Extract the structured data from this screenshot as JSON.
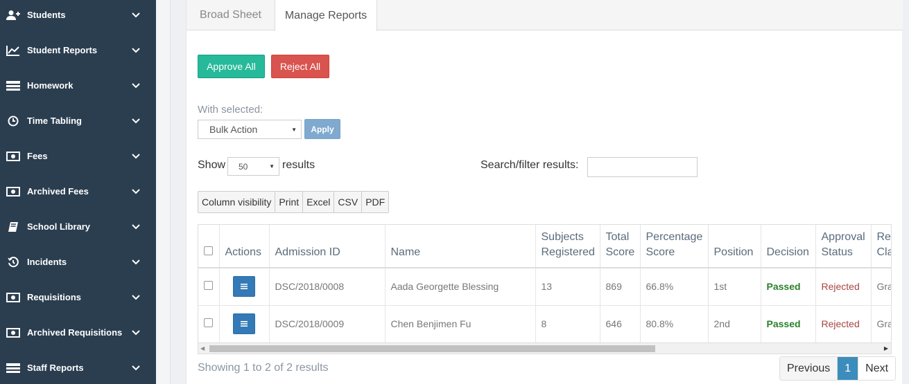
{
  "sidebar": {
    "items": [
      {
        "label": "Students",
        "icon": "user-plus-icon"
      },
      {
        "label": "Student Reports",
        "icon": "line-chart-icon"
      },
      {
        "label": "Homework",
        "icon": "server-icon"
      },
      {
        "label": "Time Tabling",
        "icon": "clock-icon"
      },
      {
        "label": "Fees",
        "icon": "money-icon"
      },
      {
        "label": "Archived Fees",
        "icon": "money-icon"
      },
      {
        "label": "School Library",
        "icon": "book-icon"
      },
      {
        "label": "Incidents",
        "icon": "history-icon"
      },
      {
        "label": "Requisitions",
        "icon": "money-icon"
      },
      {
        "label": "Archived Requisitions",
        "icon": "money-icon"
      },
      {
        "label": "Staff Reports",
        "icon": "server-icon"
      }
    ]
  },
  "tabs": [
    {
      "label": "Broad Sheet"
    },
    {
      "label": "Manage Reports"
    }
  ],
  "actions": {
    "approve_all": "Approve All",
    "reject_all": "Reject All",
    "with_selected": "With selected:",
    "bulk_action": "Bulk Action",
    "apply": "Apply"
  },
  "table_controls": {
    "show": "Show",
    "page_size": "50",
    "results": "results",
    "search_label": "Search/filter results:",
    "search_value": ""
  },
  "export_buttons": [
    "Column visibility",
    "Print",
    "Excel",
    "CSV",
    "PDF"
  ],
  "table": {
    "headers": [
      "Actions",
      "Admission ID",
      "Name",
      "Subjects Registered",
      "Total Score",
      "Percentage Score",
      "Position",
      "Decision",
      "Approval Status",
      "Result Class"
    ],
    "rows": [
      {
        "admission_id": "DSC/2018/0008",
        "name": "Aada Georgette Blessing",
        "subjects": "13",
        "total": "869",
        "percentage": "66.8%",
        "position": "1st",
        "decision": "Passed",
        "approval": "Rejected",
        "result_class": "Gra"
      },
      {
        "admission_id": "DSC/2018/0009",
        "name": "Chen Benjimen Fu",
        "subjects": "8",
        "total": "646",
        "percentage": "80.8%",
        "position": "2nd",
        "decision": "Passed",
        "approval": "Rejected",
        "result_class": "Gra"
      }
    ]
  },
  "footer": {
    "showing": "Showing 1 to 2 of 2 results",
    "previous": "Previous",
    "page": "1",
    "next": "Next"
  },
  "colors": {
    "sidebar_bg": "#2b3e50",
    "approve": "#26b99a",
    "reject": "#d9534f",
    "apply": "#7fa9cf",
    "action_btn": "#337ab7",
    "passed": "#2a7f2a",
    "rejected": "#a94442",
    "pager_active": "#3c8dbc"
  }
}
